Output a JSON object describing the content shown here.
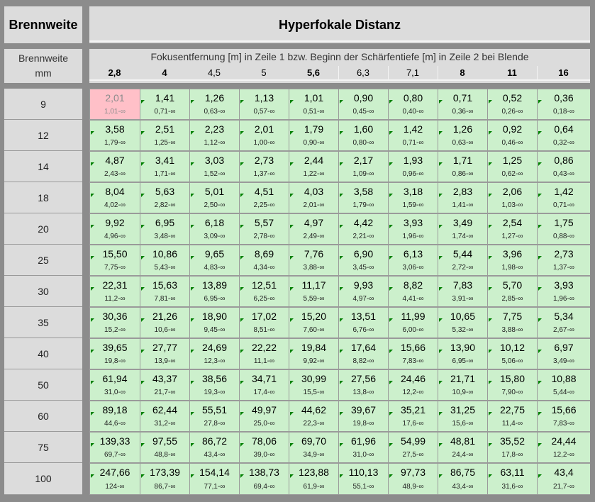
{
  "header": {
    "left_title": "Brennweite",
    "right_title": "Hyperfokale Distanz",
    "fl_label_1": "Brennweite",
    "fl_label_2": "mm",
    "description": "Fokusentfernung [m] in Zeile 1 bzw. Beginn der Schärfentiefe [m] in Zeile 2 bei Blende"
  },
  "apertures": [
    {
      "label": "2,8",
      "bold": true
    },
    {
      "label": "4",
      "bold": true
    },
    {
      "label": "4,5",
      "bold": false
    },
    {
      "label": "5",
      "bold": false
    },
    {
      "label": "5,6",
      "bold": true
    },
    {
      "label": "6,3",
      "bold": false
    },
    {
      "label": "7,1",
      "bold": false
    },
    {
      "label": "8",
      "bold": true
    },
    {
      "label": "11",
      "bold": true
    },
    {
      "label": "16",
      "bold": true
    }
  ],
  "colors": {
    "cell_background": "#ccf0cc",
    "highlight_background": "#ffc0c8",
    "marker": "#008000"
  },
  "highlight_cell": {
    "row": 0,
    "col": 0
  },
  "rows": [
    {
      "fl": "9",
      "values": [
        "2,01",
        "1,41",
        "1,26",
        "1,13",
        "1,01",
        "0,90",
        "0,80",
        "0,71",
        "0,52",
        "0,36"
      ],
      "ranges": [
        "1,01-∞",
        "0,71-∞",
        "0,63-∞",
        "0,57-∞",
        "0,51-∞",
        "0,45-∞",
        "0,40-∞",
        "0,36-∞",
        "0,26-∞",
        "0,18-∞"
      ]
    },
    {
      "fl": "12",
      "values": [
        "3,58",
        "2,51",
        "2,23",
        "2,01",
        "1,79",
        "1,60",
        "1,42",
        "1,26",
        "0,92",
        "0,64"
      ],
      "ranges": [
        "1,79-∞",
        "1,25-∞",
        "1,12-∞",
        "1,00-∞",
        "0,90-∞",
        "0,80-∞",
        "0,71-∞",
        "0,63-∞",
        "0,46-∞",
        "0,32-∞"
      ]
    },
    {
      "fl": "14",
      "values": [
        "4,87",
        "3,41",
        "3,03",
        "2,73",
        "2,44",
        "2,17",
        "1,93",
        "1,71",
        "1,25",
        "0,86"
      ],
      "ranges": [
        "2,43-∞",
        "1,71-∞",
        "1,52-∞",
        "1,37-∞",
        "1,22-∞",
        "1,09-∞",
        "0,96-∞",
        "0,86-∞",
        "0,62-∞",
        "0,43-∞"
      ]
    },
    {
      "fl": "18",
      "values": [
        "8,04",
        "5,63",
        "5,01",
        "4,51",
        "4,03",
        "3,58",
        "3,18",
        "2,83",
        "2,06",
        "1,42"
      ],
      "ranges": [
        "4,02-∞",
        "2,82-∞",
        "2,50-∞",
        "2,25-∞",
        "2,01-∞",
        "1,79-∞",
        "1,59-∞",
        "1,41-∞",
        "1,03-∞",
        "0,71-∞"
      ]
    },
    {
      "fl": "20",
      "values": [
        "9,92",
        "6,95",
        "6,18",
        "5,57",
        "4,97",
        "4,42",
        "3,93",
        "3,49",
        "2,54",
        "1,75"
      ],
      "ranges": [
        "4,96-∞",
        "3,48-∞",
        "3,09-∞",
        "2,78-∞",
        "2,49-∞",
        "2,21-∞",
        "1,96-∞",
        "1,74-∞",
        "1,27-∞",
        "0,88-∞"
      ]
    },
    {
      "fl": "25",
      "values": [
        "15,50",
        "10,86",
        "9,65",
        "8,69",
        "7,76",
        "6,90",
        "6,13",
        "5,44",
        "3,96",
        "2,73"
      ],
      "ranges": [
        "7,75-∞",
        "5,43-∞",
        "4,83-∞",
        "4,34-∞",
        "3,88-∞",
        "3,45-∞",
        "3,06-∞",
        "2,72-∞",
        "1,98-∞",
        "1,37-∞"
      ]
    },
    {
      "fl": "30",
      "values": [
        "22,31",
        "15,63",
        "13,89",
        "12,51",
        "11,17",
        "9,93",
        "8,82",
        "7,83",
        "5,70",
        "3,93"
      ],
      "ranges": [
        "11,2-∞",
        "7,81-∞",
        "6,95-∞",
        "6,25-∞",
        "5,59-∞",
        "4,97-∞",
        "4,41-∞",
        "3,91-∞",
        "2,85-∞",
        "1,96-∞"
      ]
    },
    {
      "fl": "35",
      "values": [
        "30,36",
        "21,26",
        "18,90",
        "17,02",
        "15,20",
        "13,51",
        "11,99",
        "10,65",
        "7,75",
        "5,34"
      ],
      "ranges": [
        "15,2-∞",
        "10,6-∞",
        "9,45-∞",
        "8,51-∞",
        "7,60-∞",
        "6,76-∞",
        "6,00-∞",
        "5,32-∞",
        "3,88-∞",
        "2,67-∞"
      ]
    },
    {
      "fl": "40",
      "values": [
        "39,65",
        "27,77",
        "24,69",
        "22,22",
        "19,84",
        "17,64",
        "15,66",
        "13,90",
        "10,12",
        "6,97"
      ],
      "ranges": [
        "19,8-∞",
        "13,9-∞",
        "12,3-∞",
        "11,1-∞",
        "9,92-∞",
        "8,82-∞",
        "7,83-∞",
        "6,95-∞",
        "5,06-∞",
        "3,49-∞"
      ]
    },
    {
      "fl": "50",
      "values": [
        "61,94",
        "43,37",
        "38,56",
        "34,71",
        "30,99",
        "27,56",
        "24,46",
        "21,71",
        "15,80",
        "10,88"
      ],
      "ranges": [
        "31,0-∞",
        "21,7-∞",
        "19,3-∞",
        "17,4-∞",
        "15,5-∞",
        "13,8-∞",
        "12,2-∞",
        "10,9-∞",
        "7,90-∞",
        "5,44-∞"
      ]
    },
    {
      "fl": "60",
      "values": [
        "89,18",
        "62,44",
        "55,51",
        "49,97",
        "44,62",
        "39,67",
        "35,21",
        "31,25",
        "22,75",
        "15,66"
      ],
      "ranges": [
        "44,6-∞",
        "31,2-∞",
        "27,8-∞",
        "25,0-∞",
        "22,3-∞",
        "19,8-∞",
        "17,6-∞",
        "15,6-∞",
        "11,4-∞",
        "7,83-∞"
      ]
    },
    {
      "fl": "75",
      "values": [
        "139,33",
        "97,55",
        "86,72",
        "78,06",
        "69,70",
        "61,96",
        "54,99",
        "48,81",
        "35,52",
        "24,44"
      ],
      "ranges": [
        "69,7-∞",
        "48,8-∞",
        "43,4-∞",
        "39,0-∞",
        "34,9-∞",
        "31,0-∞",
        "27,5-∞",
        "24,4-∞",
        "17,8-∞",
        "12,2-∞"
      ]
    },
    {
      "fl": "100",
      "values": [
        "247,66",
        "173,39",
        "154,14",
        "138,73",
        "123,88",
        "110,13",
        "97,73",
        "86,75",
        "63,11",
        "43,4"
      ],
      "ranges": [
        "124-∞",
        "86,7-∞",
        "77,1-∞",
        "69,4-∞",
        "61,9-∞",
        "55,1-∞",
        "48,9-∞",
        "43,4-∞",
        "31,6-∞",
        "21,7-∞"
      ]
    }
  ]
}
